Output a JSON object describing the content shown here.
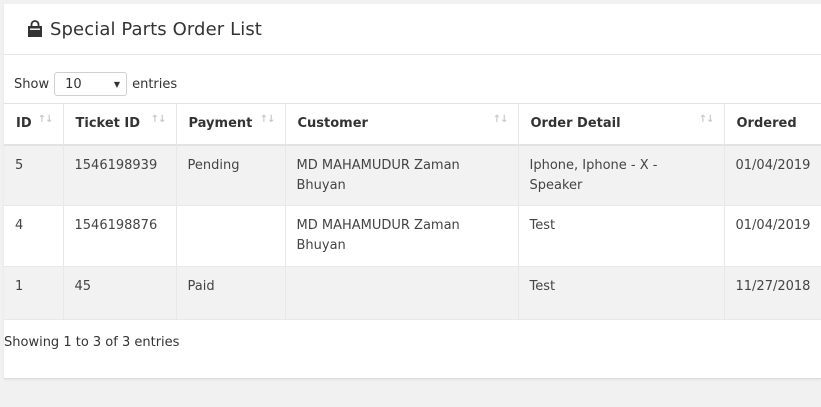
{
  "panel": {
    "title": "Special Parts Order List",
    "title_icon": "shopping-bag-icon"
  },
  "length_menu": {
    "show_label": "Show",
    "selected": "10",
    "entries_label": "entries"
  },
  "table": {
    "columns": [
      "ID",
      "Ticket ID",
      "Payment",
      "Customer",
      "Order Detail",
      "Ordered"
    ],
    "rows": [
      {
        "id": "5",
        "ticket_id": "1546198939",
        "payment": "Pending",
        "customer": "MD MAHAMUDUR Zaman Bhuyan",
        "order_detail": "Iphone, Iphone - X - Speaker",
        "ordered": "01/04/2019"
      },
      {
        "id": "4",
        "ticket_id": "1546198876",
        "payment": "",
        "customer": "MD MAHAMUDUR Zaman Bhuyan",
        "order_detail": "Test",
        "ordered": "01/04/2019"
      },
      {
        "id": "1",
        "ticket_id": "45",
        "payment": "Paid",
        "customer": "",
        "order_detail": "Test",
        "ordered": "11/27/2018"
      }
    ]
  },
  "info_text": "Showing 1 to 3 of 3 entries",
  "colors": {
    "page_bg": "#f1f1f1",
    "stripe": "#f2f2f2",
    "border": "#e8e8e8"
  }
}
